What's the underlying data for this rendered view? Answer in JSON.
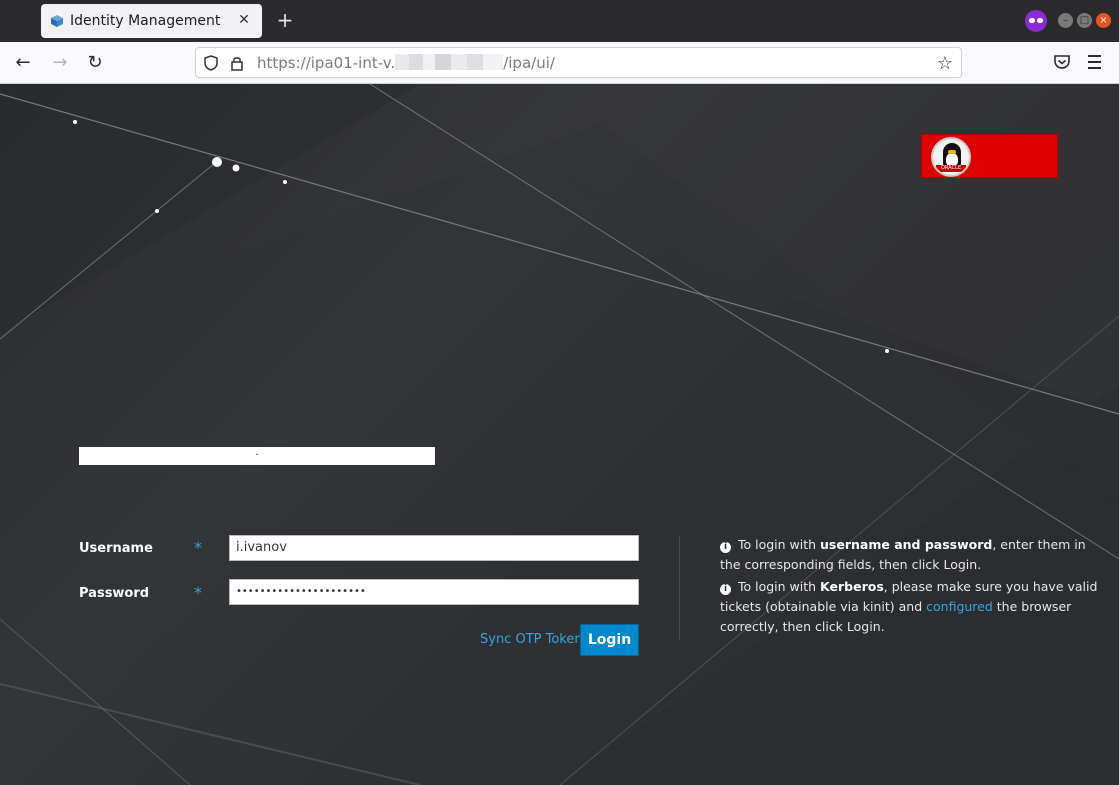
{
  "browser": {
    "tab_title": "Identity Management",
    "tab_close": "✕",
    "new_tab": "+",
    "url_prefix": "https://ipa01-int-v.",
    "url_suffix": "/ipa/ui/",
    "star": "☆",
    "nav_back": "←",
    "nav_forward": "→",
    "nav_reload": "↻",
    "win_minimize": "–",
    "win_maximize": "□",
    "win_close": "×"
  },
  "brand": {
    "badge_text": "ORACLE",
    "badge_color": "#e10000"
  },
  "banner": {
    "text": "."
  },
  "form": {
    "username_label": "Username",
    "password_label": "Password",
    "required_marker": "*",
    "username_value": "i.ivanov",
    "password_value": "••••••••••••••••••••••",
    "sync_otp_label": "Sync OTP Token",
    "login_label": "Login"
  },
  "help": {
    "info_glyph": "i",
    "line1_pre": " To login with ",
    "line1_bold": "username and password",
    "line1_post": ", enter them in the corresponding fields, then click Login.",
    "line2_pre": " To login with ",
    "line2_bold": "Kerberos",
    "line2_mid": ", please make sure you have valid tickets (obtainable via kinit) and ",
    "line2_link": "configured",
    "line2_post": " the browser correctly, then click Login."
  },
  "colors": {
    "accent": "#0088ce",
    "link": "#39a5dc",
    "background": "#2f3033"
  },
  "icons": [
    "favicon-cube-icon",
    "close-icon",
    "plus-icon",
    "privacy-mask-icon",
    "back-arrow-icon",
    "forward-arrow-icon",
    "reload-icon",
    "shield-icon",
    "lock-icon",
    "star-icon",
    "pocket-icon",
    "hamburger-menu-icon",
    "info-icon",
    "tux-penguin-icon"
  ]
}
